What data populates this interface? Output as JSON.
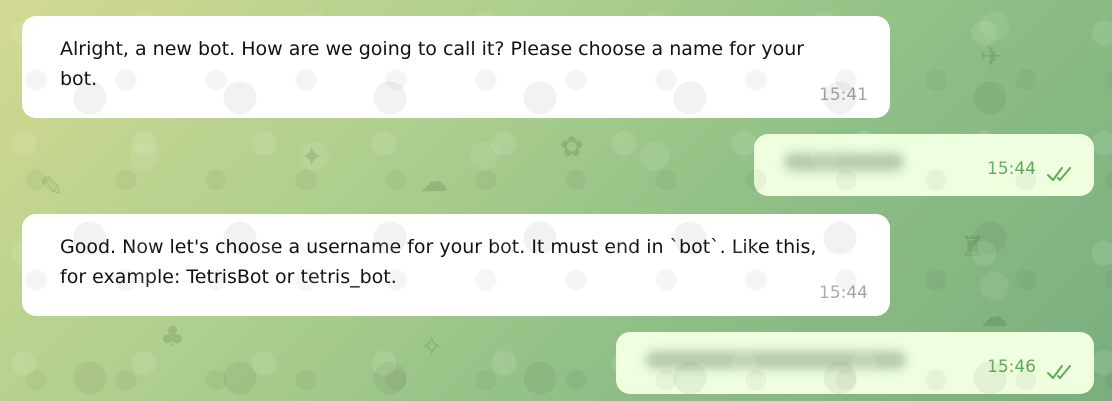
{
  "messages": [
    {
      "direction": "incoming",
      "text": "Alright, a new bot. How are we going to call it? Please choose a name for your bot.",
      "time": "15:41"
    },
    {
      "direction": "outgoing",
      "text": "c0000testbot",
      "time": "15:44",
      "status_icon": "double-check-icon",
      "redacted": true
    },
    {
      "direction": "incoming",
      "text": "Good. Now let's choose a username for your bot. It must end in `bot`. Like this, for example: TetrisBot or tetris_bot.",
      "time": "15:44"
    },
    {
      "direction": "outgoing",
      "text": "c0000_telegram_test_bot",
      "time": "15:46",
      "status_icon": "double-check-icon",
      "redacted": true
    }
  ],
  "colors": {
    "incoming_bubble": "#ffffff",
    "outgoing_bubble": "#eefedf",
    "incoming_time": "#a3a7ab",
    "outgoing_time": "#5eaa58",
    "check": "#5eaa58"
  }
}
